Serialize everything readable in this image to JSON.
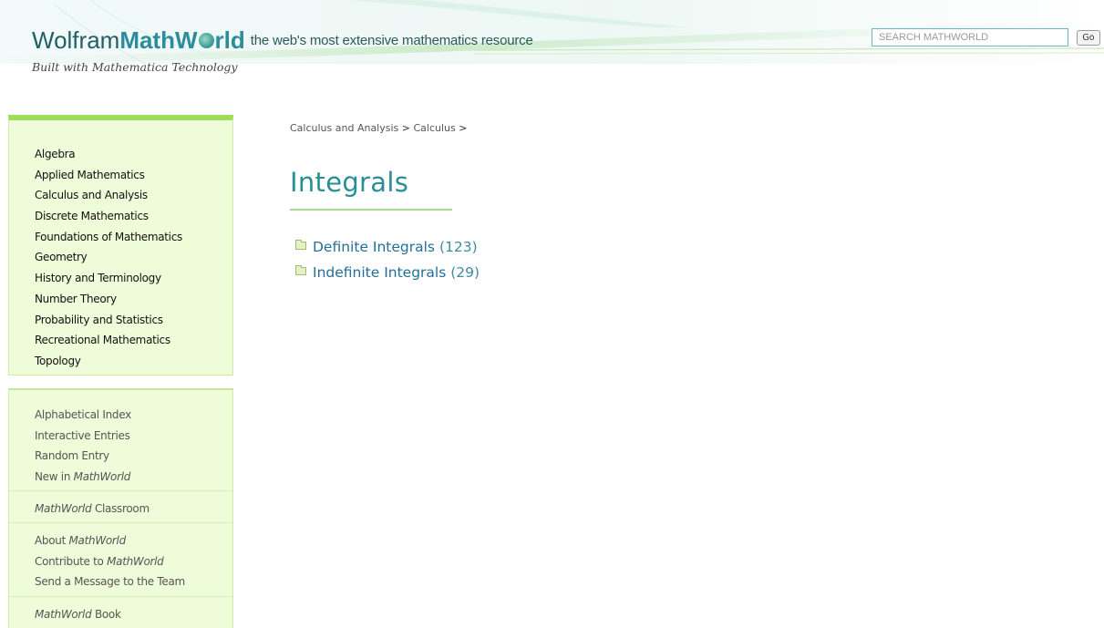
{
  "header": {
    "logo_wolfram": "Wolfram",
    "logo_math": "Math",
    "logo_w": "W",
    "logo_rld": "rld",
    "tagline": "the web's most extensive mathematics resource",
    "built_with": "Built with Mathematica Technology",
    "search_placeholder": "SEARCH MATHWORLD",
    "go_label": "Go"
  },
  "sidebar": {
    "topics": [
      "Algebra",
      "Applied Mathematics",
      "Calculus and Analysis",
      "Discrete Mathematics",
      "Foundations of Mathematics",
      "Geometry",
      "History and Terminology",
      "Number Theory",
      "Probability and Statistics",
      "Recreational Mathematics",
      "Topology"
    ],
    "nav": {
      "alphabetical_index": "Alphabetical Index",
      "interactive_entries": "Interactive Entries",
      "random_entry": "Random Entry",
      "new_in_prefix": "New in",
      "mathworld": "MathWorld",
      "classroom_suffix": "Classroom",
      "about_prefix": "About",
      "contribute_prefix": "Contribute to",
      "send_message": "Send a Message to the Team",
      "book_suffix": "Book"
    }
  },
  "breadcrumb": {
    "items": [
      "Calculus and Analysis",
      "Calculus"
    ],
    "separator": ">"
  },
  "page": {
    "title": "Integrals",
    "categories": [
      {
        "label": "Definite Integrals",
        "count": "(123)"
      },
      {
        "label": "Indefinite Integrals",
        "count": "(29)"
      }
    ]
  },
  "colors": {
    "accent_teal": "#2a8f94",
    "link_blue": "#236f97",
    "sidebar_bg": "#effcd9",
    "sidebar_top_bar": "#9fdc5a"
  }
}
